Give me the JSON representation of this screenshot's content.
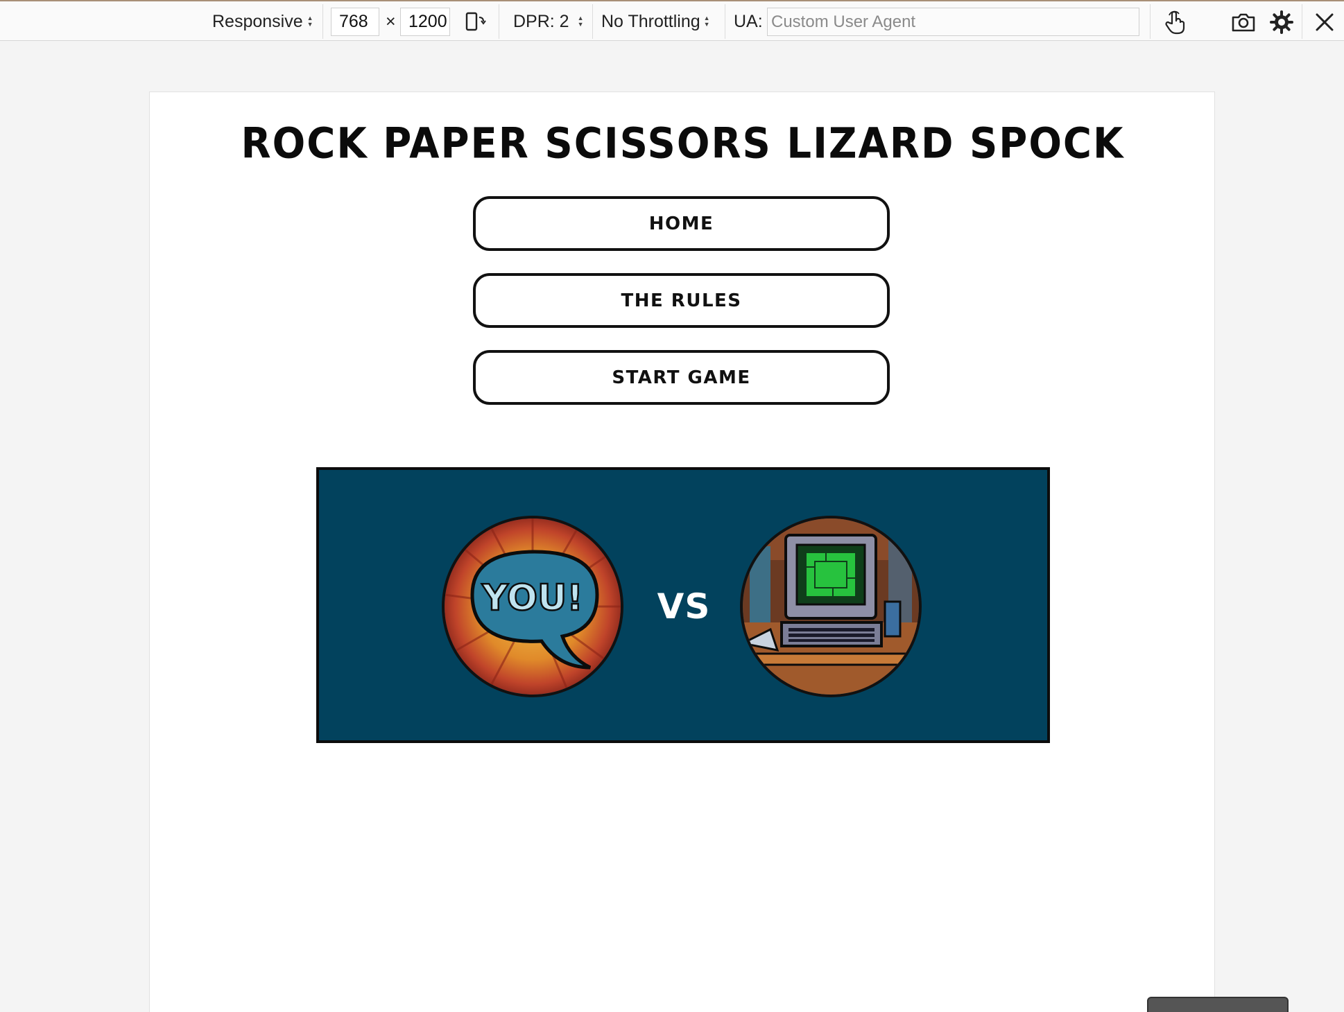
{
  "toolbar": {
    "device_mode": "Responsive",
    "width": "768",
    "times": "×",
    "height": "1200",
    "dpr": "DPR: 2",
    "throttling": "No Throttling",
    "ua_label": "UA:",
    "ua_placeholder": "Custom User Agent",
    "icons": [
      "rotate-device-icon",
      "touch-icon",
      "camera-icon",
      "settings-gear-icon",
      "close-icon"
    ]
  },
  "page": {
    "title": "Rock Paper Scissors Lizard Spock",
    "nav": {
      "home": "Home",
      "rules": "The Rules",
      "start": "Start Game"
    },
    "arena": {
      "player_label": "YOU!",
      "vs": "VS",
      "background": "#02425d"
    }
  }
}
